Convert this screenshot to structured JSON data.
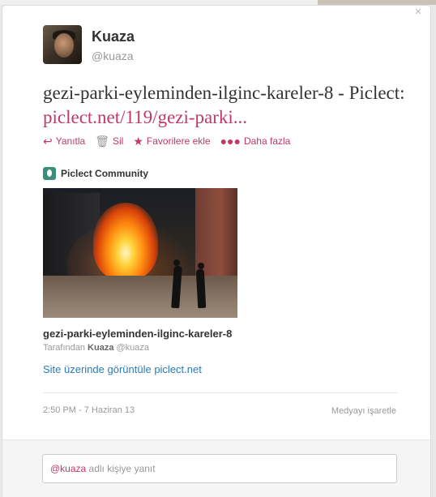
{
  "author": {
    "fullname": "Kuaza",
    "username": "@kuaza"
  },
  "tweet": {
    "text": "gezi-parki-eyleminden-ilginc-kareler-8 - Piclect: ",
    "link": "piclect.net/119/gezi-parki..."
  },
  "actions": {
    "reply": "Yanıtla",
    "delete": "Sil",
    "favorite": "Favorilere ekle",
    "more": "Daha fazla"
  },
  "card": {
    "community": "Piclect Community",
    "title": "gezi-parki-eyleminden-ilginc-kareler-8",
    "byline_prefix": "Tarafından",
    "byline_name": "Kuaza",
    "byline_handle": "@kuaza",
    "view_link": "Site üzerinde görüntüle piclect.net"
  },
  "meta": {
    "timestamp": "2:50 PM - 7 Haziran 13",
    "flag_media": "Medyayı işaretle"
  },
  "reply": {
    "mention": "@kuaza",
    "placeholder": "adlı kişiye yanıt"
  },
  "colors": {
    "accent": "#c0396b",
    "link_blue": "#2b7bb9"
  }
}
